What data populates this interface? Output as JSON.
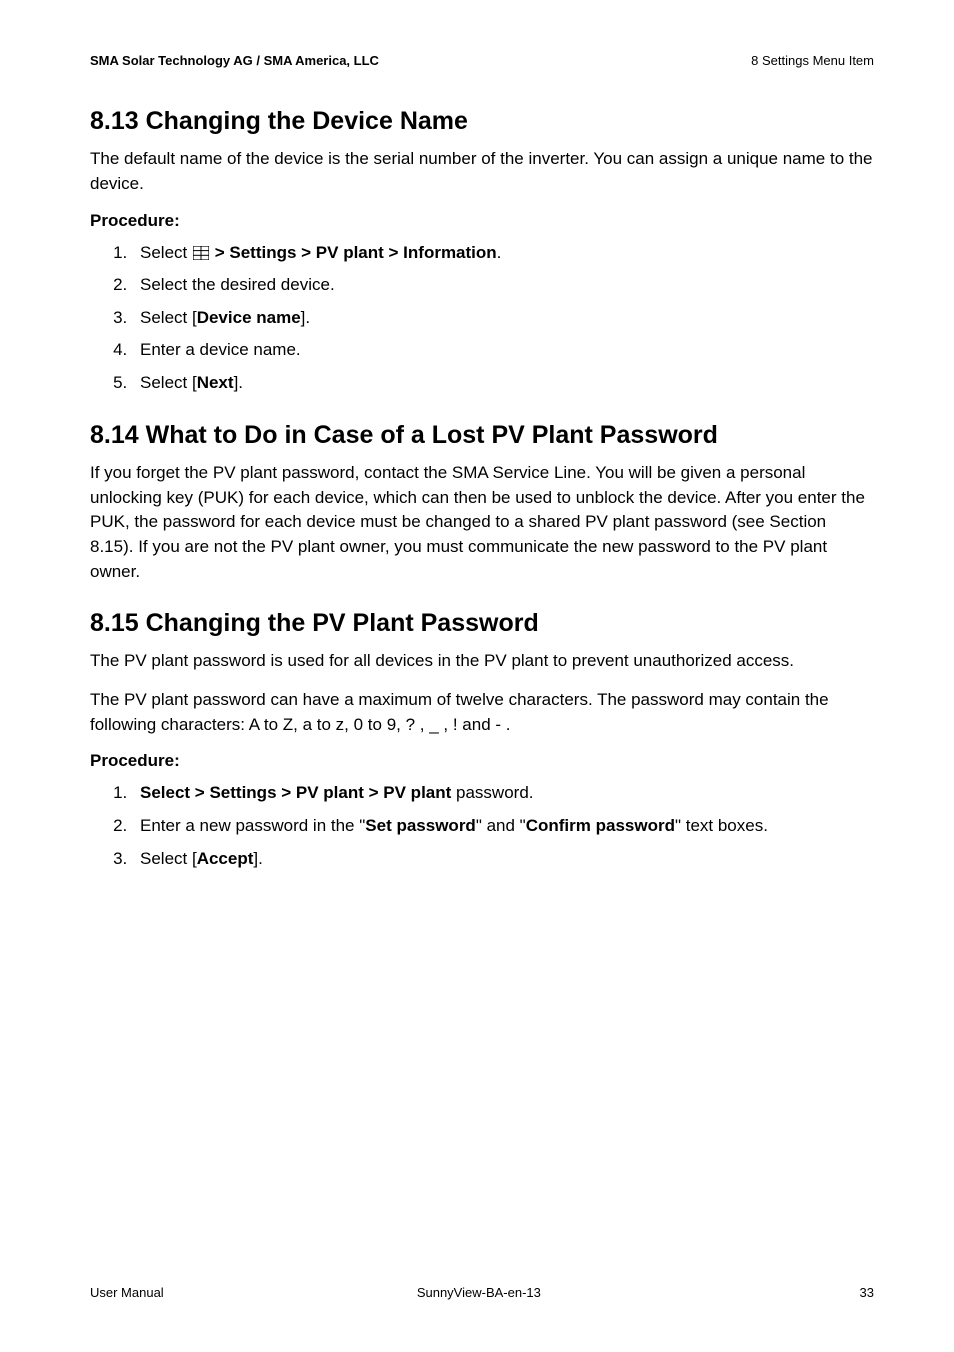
{
  "header": {
    "left": "SMA Solar Technology AG / SMA America, LLC",
    "right": "8  Settings Menu Item"
  },
  "s813": {
    "title": "8.13 Changing the Device Name",
    "intro": "The default name of the device is the serial number of the inverter. You can assign a unique name to the device.",
    "procLabel": "Procedure:",
    "step1_pre": "Select ",
    "step1_post": " > Settings > PV plant > Information",
    "step1_period": ".",
    "step2": "Select the desired device.",
    "step3_pre": "Select [",
    "step3_bold": "Device name",
    "step3_post": "].",
    "step4": "Enter a device name.",
    "step5_pre": "Select [",
    "step5_bold": "Next",
    "step5_post": "]."
  },
  "s814": {
    "title": "8.14 What to Do in Case of a Lost PV Plant Password",
    "body": "If you forget the PV plant password, contact the SMA Service Line. You will be given a personal unlocking key (PUK) for each device, which can then be used to unblock the device. After you enter the PUK, the password for each device must be changed to a shared PV plant password (see Section 8.15). If you are not the PV plant owner, you must communicate the new password to the PV plant owner."
  },
  "s815": {
    "title": "8.15 Changing the PV Plant Password",
    "p1": "The PV plant password is used for all devices in the PV plant to prevent unauthorized access.",
    "p2": "The PV plant password can have a maximum of twelve characters. The password may contain the following characters: A to Z, a to z, 0 to 9, ? , _ , ! and - .",
    "procLabel": "Procedure:",
    "step1_bold": "Select  > Settings > PV plant > PV plant",
    "step1_rest": " password.",
    "step2_pre": "Enter a new password in the \"",
    "step2_b1": "Set password",
    "step2_mid": "\" and \"",
    "step2_b2": "Confirm password",
    "step2_post": "\" text boxes.",
    "step3_pre": "Select [",
    "step3_bold": "Accept",
    "step3_post": "]."
  },
  "footer": {
    "left": "User Manual",
    "center": "SunnyView-BA-en-13",
    "page": "33"
  }
}
